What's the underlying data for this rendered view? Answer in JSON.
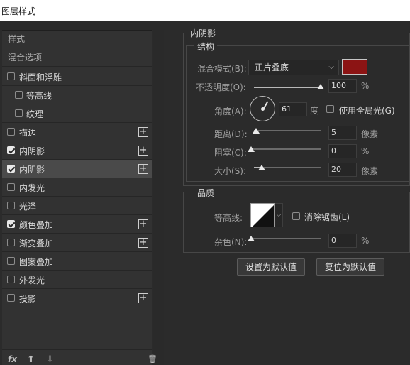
{
  "window": {
    "title": "图层样式"
  },
  "sidebar": {
    "styles_label": "样式",
    "blending_label": "混合选项",
    "items": [
      {
        "label": "斜面和浮雕",
        "checked": false,
        "plus": false,
        "indent": false
      },
      {
        "label": "等高线",
        "checked": false,
        "plus": false,
        "indent": true
      },
      {
        "label": "纹理",
        "checked": false,
        "plus": false,
        "indent": true
      },
      {
        "label": "描边",
        "checked": false,
        "plus": true,
        "indent": false
      },
      {
        "label": "内阴影",
        "checked": true,
        "plus": true,
        "indent": false
      },
      {
        "label": "内阴影",
        "checked": true,
        "plus": true,
        "indent": false,
        "selected": true
      },
      {
        "label": "内发光",
        "checked": false,
        "plus": false,
        "indent": false
      },
      {
        "label": "光泽",
        "checked": false,
        "plus": false,
        "indent": false
      },
      {
        "label": "颜色叠加",
        "checked": true,
        "plus": true,
        "indent": false
      },
      {
        "label": "渐变叠加",
        "checked": false,
        "plus": true,
        "indent": false
      },
      {
        "label": "图案叠加",
        "checked": false,
        "plus": false,
        "indent": false
      },
      {
        "label": "外发光",
        "checked": false,
        "plus": false,
        "indent": false
      },
      {
        "label": "投影",
        "checked": false,
        "plus": true,
        "indent": false
      }
    ],
    "plus_glyph": "+",
    "tools": {
      "fx": "fx",
      "up": "⬆",
      "down": "⬇",
      "trash": "🗑"
    }
  },
  "panel": {
    "title": "内阴影",
    "structure": {
      "title": "结构",
      "blend_mode_label": "混合模式(B):",
      "blend_mode_value": "正片叠底",
      "color": "#8c1414",
      "opacity_label": "不透明度(O):",
      "opacity_value": "100",
      "opacity_unit": "%",
      "opacity_fraction": 1.0,
      "angle_label": "角度(A):",
      "angle_value": "61",
      "angle_unit": "度",
      "global_light_label": "使用全局光(G)",
      "global_light_checked": false,
      "distance_label": "距离(D):",
      "distance_value": "5",
      "distance_unit": "像素",
      "distance_fraction": 0.03,
      "choke_label": "阻塞(C):",
      "choke_value": "0",
      "choke_unit": "%",
      "choke_fraction": 0.0,
      "size_label": "大小(S):",
      "size_value": "20",
      "size_unit": "像素",
      "size_fraction": 0.12
    },
    "quality": {
      "title": "品质",
      "contour_label": "等高线:",
      "anti_alias_label": "消除锯齿(L)",
      "anti_alias_checked": false,
      "noise_label": "杂色(N):",
      "noise_value": "0",
      "noise_unit": "%",
      "noise_fraction": 0.0
    },
    "buttons": {
      "make_default": "设置为默认值",
      "reset_default": "复位为默认值"
    }
  },
  "icons": {
    "dropdown": "chevron-down-icon",
    "angle": "angle-dial-icon"
  }
}
